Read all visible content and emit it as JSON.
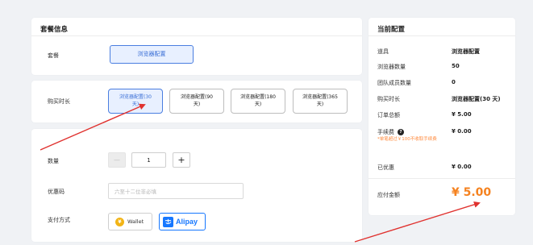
{
  "package_info": {
    "title": "套餐信息",
    "package_label": "套餐",
    "package_button": "浏览器配置"
  },
  "duration": {
    "label": "购买时长",
    "options": [
      {
        "line1": "浏览器配置(30",
        "line2": "天)"
      },
      {
        "line1": "浏览器配置(90",
        "line2": "天)"
      },
      {
        "line1": "浏览器配置(180",
        "line2": "天)"
      },
      {
        "line1": "浏览器配置(365",
        "line2": "天)"
      }
    ],
    "selected_index": 0
  },
  "order": {
    "quantity_label": "数量",
    "quantity_value": "1",
    "minus_symbol": "—",
    "plus_symbol": "+",
    "coupon_label": "优惠码",
    "coupon_placeholder": "六至十二位非必填",
    "payment_label": "支付方式",
    "wallet_label": "Wallet",
    "alipay_label": "Alipay",
    "selected_payment": "Alipay"
  },
  "summary": {
    "title": "当前配置",
    "rows": [
      {
        "label": "道具",
        "value": "浏览器配置"
      },
      {
        "label": "浏览器数量",
        "value": "50"
      },
      {
        "label": "团队成员数量",
        "value": "0"
      },
      {
        "label": "购买时长",
        "value": "浏览器配置(30 天)"
      },
      {
        "label": "订单总额",
        "value": "¥ 5.00"
      },
      {
        "label": "手续费",
        "value": "¥ 0.00"
      }
    ],
    "fee_note": "*单笔超过￥100不收取手续费",
    "discount_label": "已优惠",
    "discount_value": "¥ 0.00",
    "total_label": "应付金额",
    "total_value": "¥ 5.00"
  },
  "colors": {
    "accent": "#3a6fd6",
    "annotation_arrow": "#e0322f",
    "total_price": "#f5821f",
    "fee_note": "#ff8a3d",
    "alipay_blue": "#1677ff",
    "wallet_coin": "#f2b416"
  }
}
